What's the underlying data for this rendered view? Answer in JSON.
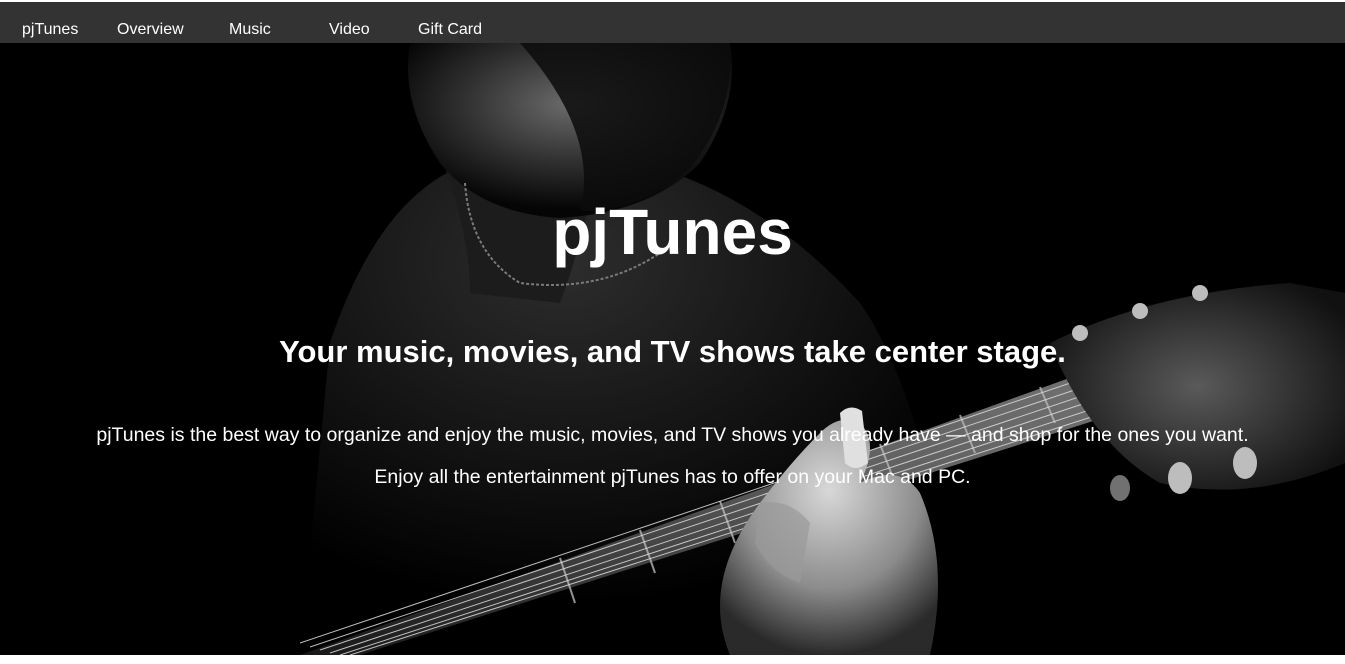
{
  "nav": {
    "brand": "pjTunes",
    "items": [
      {
        "label": "Overview"
      },
      {
        "label": "Music"
      },
      {
        "label": "Video"
      },
      {
        "label": "Gift Card"
      }
    ]
  },
  "hero": {
    "title": "pjTunes",
    "subtitle": "Your music, movies, and TV shows take center stage.",
    "description": "pjTunes is the best way to organize and enjoy the music, movies, and TV shows you already have — and shop for the ones you want. Enjoy all the entertainment pjTunes has to offer on your Mac and PC."
  },
  "colors": {
    "nav_background": "#333333",
    "hero_background": "#000000",
    "text": "#ffffff"
  }
}
